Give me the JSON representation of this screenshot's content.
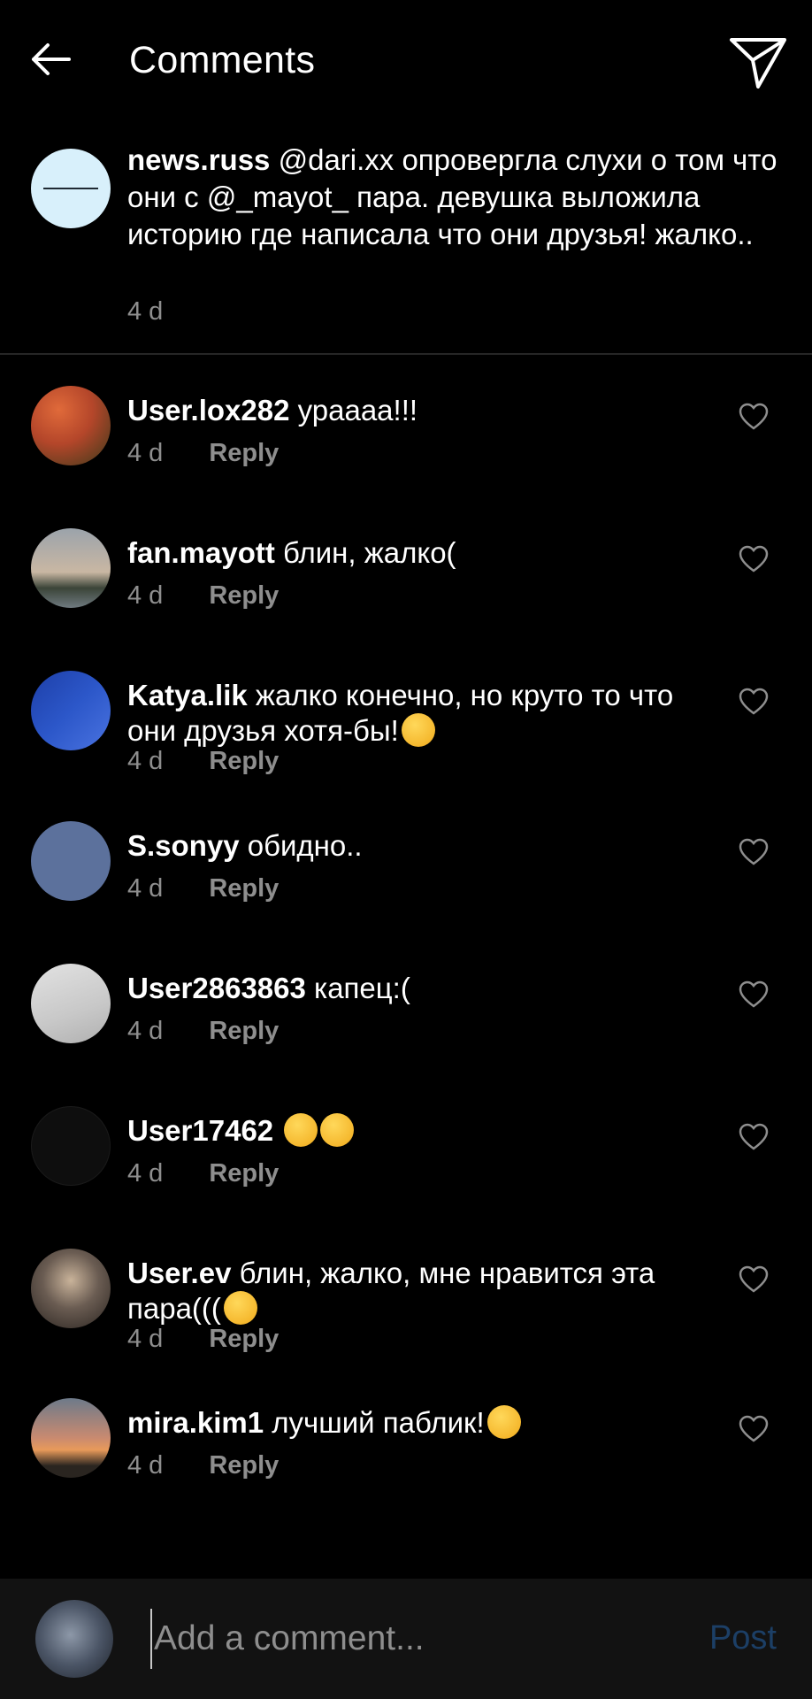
{
  "header": {
    "title": "Comments",
    "back_icon": "arrow-left-icon",
    "share_icon": "paper-plane-icon"
  },
  "caption": {
    "username": "news.russ",
    "text": "@dari.xx опровергла слухи о том что они с @_mayot_ пара. девушка выложила историю где написала что они друзья! жалко..",
    "time": "4 d"
  },
  "comments": [
    {
      "username": "User.lox282",
      "text": "урааaa!!!",
      "time": "4 d",
      "reply_label": "Reply",
      "avatar_color": "#b4462a"
    },
    {
      "username": "fan.mayott",
      "text": "блин, жалко(",
      "time": "4 d",
      "reply_label": "Reply",
      "avatar_color": "#9aa0a4"
    },
    {
      "username": "Katya.lik",
      "text": "жалко конечно, но круто то что они друзья хотя-бы!",
      "emoji": "heart-eyes-emoji",
      "time": "4 d",
      "reply_label": "Reply",
      "avatar_color": "#2c57c9"
    },
    {
      "username": "S.sonyy",
      "text": "обидно..",
      "time": "4 d",
      "reply_label": "Reply",
      "avatar_color": "#5c719c"
    },
    {
      "username": "User2863863",
      "text": "капец:(",
      "time": "4 d",
      "reply_label": "Reply",
      "avatar_color": "#cfcfcf"
    },
    {
      "username": "User17462",
      "text": "",
      "emoji": "pensive-face-emoji",
      "time": "4 d",
      "reply_label": "Reply",
      "avatar_color": "#111111"
    },
    {
      "username": "User.ev",
      "text": "блин, жалко, мне нравится эта пара(((",
      "emoji": "crying-face-emoji",
      "time": "4 d",
      "reply_label": "Reply",
      "avatar_color": "#6a5c52"
    },
    {
      "username": "mira.kim1",
      "text": "лучший паблик!",
      "emoji": "partying-face-emoji",
      "time": "4 d",
      "reply_label": "Reply",
      "avatar_color": "#c98a70"
    }
  ],
  "input": {
    "placeholder": "Add a comment...",
    "post_label": "Post"
  },
  "colors": {
    "background": "#000000",
    "secondary_text": "#8e8e8e",
    "post_disabled": "#1c3f66",
    "divider": "#262626"
  }
}
